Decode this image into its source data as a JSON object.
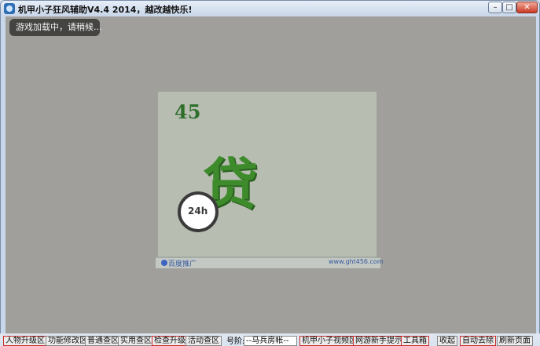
{
  "window": {
    "title": "机甲小子狂风辅助V4.4  2014，越改越快乐!",
    "minimize_glyph": "–",
    "maximize_glyph": "□",
    "close_glyph": "✕"
  },
  "toast": {
    "text": "游戏加载中，请稍候..."
  },
  "ad": {
    "logo_text": "45",
    "glyph_text": "贷",
    "clock_label": "24h",
    "source_text": "百度推广",
    "url_text": "www.ght456.com"
  },
  "toolbar": {
    "buttons": [
      "人物升级区",
      "功能修改区",
      "普通查区",
      "实用查区",
      "检查升级",
      "活动查区"
    ],
    "account_label": "号阶:",
    "account_value": "--马兵房帐--",
    "right_buttons": [
      "机甲小子视频区",
      "网游新手提示",
      "工具箱",
      "收起",
      "自动去除",
      "刷新页面"
    ]
  },
  "colors": {
    "content_bg": "#a19f9b",
    "titlebar_top": "#e6eef8",
    "ad_green": "#3e8b2c"
  }
}
